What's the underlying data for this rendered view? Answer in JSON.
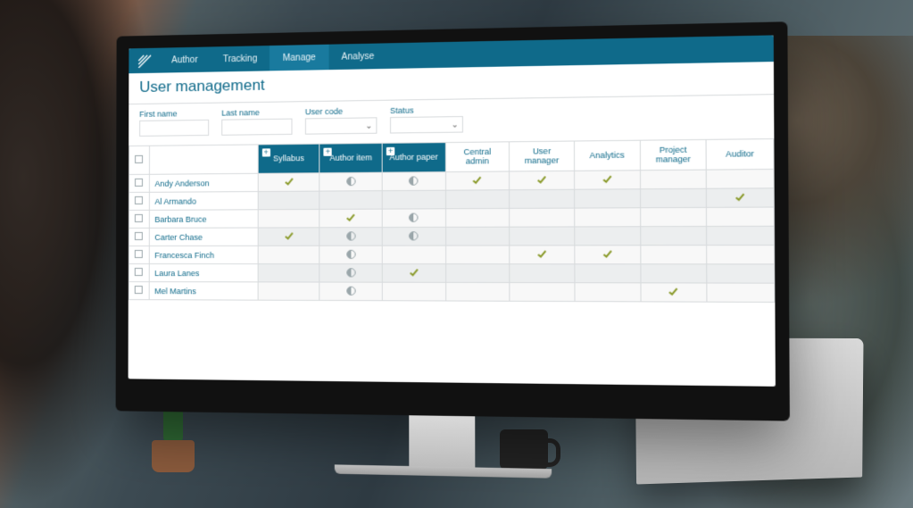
{
  "nav": {
    "tabs": [
      "Author",
      "Tracking",
      "Manage",
      "Analyse"
    ],
    "active_index": 2
  },
  "page": {
    "title": "User management"
  },
  "filters": {
    "first_name": {
      "label": "First name",
      "value": ""
    },
    "last_name": {
      "label": "Last name",
      "value": ""
    },
    "user_code": {
      "label": "User code",
      "value": ""
    },
    "status": {
      "label": "Status",
      "value": ""
    }
  },
  "columns": {
    "syllabus": {
      "label": "Syllabus",
      "dark": true,
      "expandable": true
    },
    "author_item": {
      "label": "Author item",
      "dark": true,
      "expandable": true
    },
    "author_paper": {
      "label": "Author paper",
      "dark": true,
      "expandable": true
    },
    "central_admin": {
      "label": "Central admin",
      "dark": false
    },
    "user_manager": {
      "label": "User manager",
      "dark": false
    },
    "analytics": {
      "label": "Analytics",
      "dark": false
    },
    "project_mgr": {
      "label": "Project manager",
      "dark": false
    },
    "auditor": {
      "label": "Auditor",
      "dark": false
    }
  },
  "users": [
    {
      "name": "Andy Anderson",
      "roles": {
        "syllabus": "tick",
        "author_item": "half",
        "author_paper": "half",
        "central_admin": "tick",
        "user_manager": "tick",
        "analytics": "tick",
        "project_mgr": "",
        "auditor": ""
      }
    },
    {
      "name": "Al Armando",
      "roles": {
        "syllabus": "",
        "author_item": "",
        "author_paper": "",
        "central_admin": "",
        "user_manager": "",
        "analytics": "",
        "project_mgr": "",
        "auditor": "tick"
      }
    },
    {
      "name": "Barbara Bruce",
      "roles": {
        "syllabus": "",
        "author_item": "tick",
        "author_paper": "half",
        "central_admin": "",
        "user_manager": "",
        "analytics": "",
        "project_mgr": "",
        "auditor": ""
      }
    },
    {
      "name": "Carter Chase",
      "roles": {
        "syllabus": "tick",
        "author_item": "half",
        "author_paper": "half",
        "central_admin": "",
        "user_manager": "",
        "analytics": "",
        "project_mgr": "",
        "auditor": ""
      }
    },
    {
      "name": "Francesca Finch",
      "roles": {
        "syllabus": "",
        "author_item": "half",
        "author_paper": "",
        "central_admin": "",
        "user_manager": "tick",
        "analytics": "tick",
        "project_mgr": "",
        "auditor": ""
      }
    },
    {
      "name": "Laura Lanes",
      "roles": {
        "syllabus": "",
        "author_item": "half",
        "author_paper": "tick",
        "central_admin": "",
        "user_manager": "",
        "analytics": "",
        "project_mgr": "",
        "auditor": ""
      }
    },
    {
      "name": "Mel Martins",
      "roles": {
        "syllabus": "",
        "author_item": "half",
        "author_paper": "",
        "central_admin": "",
        "user_manager": "",
        "analytics": "",
        "project_mgr": "tick",
        "auditor": ""
      }
    }
  ],
  "icons": {
    "tick_title": "granted",
    "half_title": "partial"
  }
}
